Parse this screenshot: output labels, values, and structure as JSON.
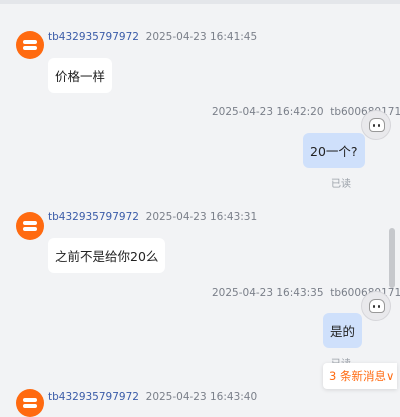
{
  "messages": [
    {
      "sender": "tb432935797972",
      "time": "2025-04-23 16:41:45",
      "text": "价格一样"
    },
    {
      "sender": "tb600680171",
      "time": "2025-04-23 16:42:20",
      "text": "20一个?",
      "status": "已读"
    },
    {
      "sender": "tb432935797972",
      "time": "2025-04-23 16:43:31",
      "text": "之前不是给你20么"
    },
    {
      "sender": "tb600680171",
      "time": "2025-04-23 16:43:35",
      "text": "是的",
      "status": "已读"
    },
    {
      "sender": "tb432935797972",
      "time": "2025-04-23 16:43:40"
    }
  ],
  "new_messages_label": "3 条新消息∨",
  "icons": {
    "shop_avatar": "shop-logo-icon",
    "user_avatar": "user-avatar-icon"
  }
}
